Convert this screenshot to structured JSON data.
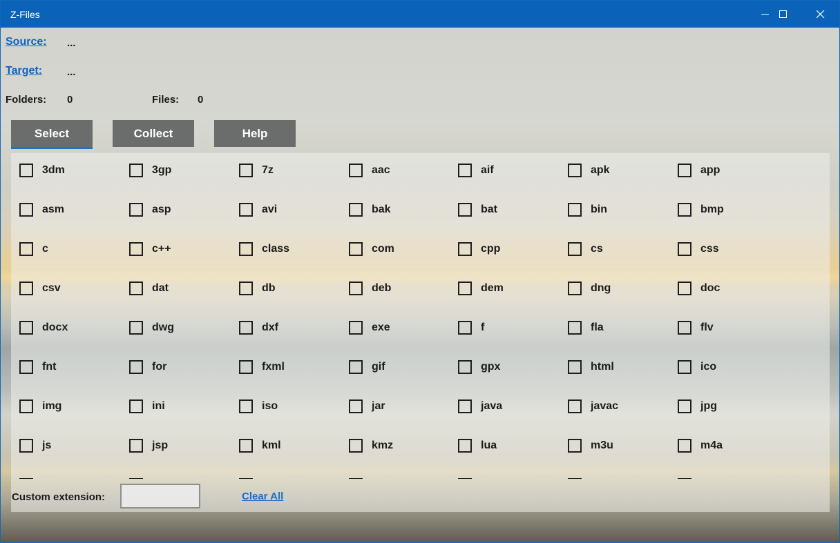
{
  "window": {
    "title": "Z-Files",
    "controls": [
      "minimize-icon",
      "maximize-icon",
      "close-icon"
    ]
  },
  "info": {
    "source_label": "Source:",
    "source_value": "...",
    "target_label": "Target:",
    "target_value": "...",
    "folders_label": "Folders:",
    "folders_value": "0",
    "files_label": "Files:",
    "files_value": "0"
  },
  "tabs": [
    {
      "label": "Select",
      "selected": true
    },
    {
      "label": "Collect",
      "selected": false
    },
    {
      "label": "Help",
      "selected": false
    }
  ],
  "extensions": [
    [
      "3dm",
      "3gp",
      "7z",
      "aac",
      "aif",
      "apk",
      "app"
    ],
    [
      "asm",
      "asp",
      "avi",
      "bak",
      "bat",
      "bin",
      "bmp"
    ],
    [
      "c",
      "c++",
      "class",
      "com",
      "cpp",
      "cs",
      "css"
    ],
    [
      "csv",
      "dat",
      "db",
      "deb",
      "dem",
      "dng",
      "doc"
    ],
    [
      "docx",
      "dwg",
      "dxf",
      "exe",
      "f",
      "fla",
      "flv"
    ],
    [
      "fnt",
      "for",
      "fxml",
      "gif",
      "gpx",
      "html",
      "ico"
    ],
    [
      "img",
      "ini",
      "iso",
      "jar",
      "java",
      "javac",
      "jpg"
    ],
    [
      "js",
      "jsp",
      "kml",
      "kmz",
      "lua",
      "m3u",
      "m4a"
    ]
  ],
  "footer": {
    "custom_label": "Custom extension:",
    "custom_value": "",
    "clear_label": "Clear All"
  },
  "colors": {
    "titlebar": "#0a63b8",
    "link": "#0b63c4",
    "tab_bg": "#6b6d6d",
    "tab_accent": "#1e73c9"
  }
}
